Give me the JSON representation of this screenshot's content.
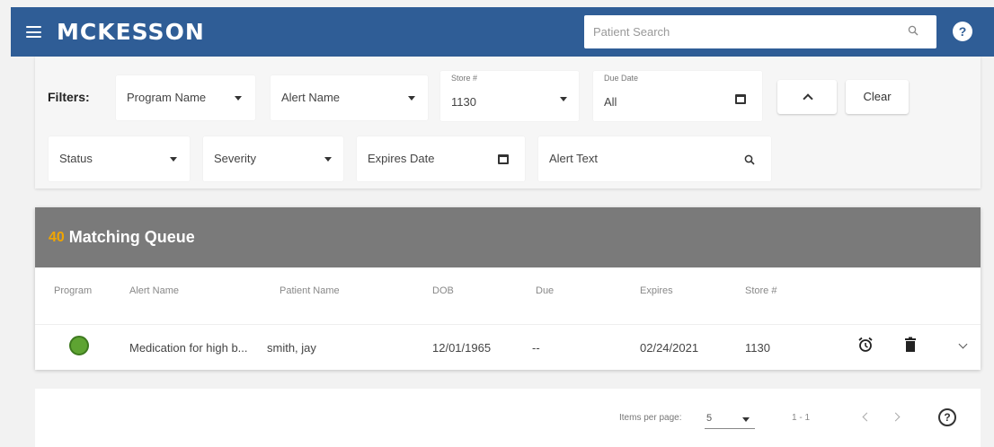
{
  "header": {
    "brand": "MCKESSON",
    "search_placeholder": "Patient Search",
    "help_glyph": "?"
  },
  "filters": {
    "label": "Filters:",
    "program_name": "Program Name",
    "alert_name": "Alert Name",
    "store_label": "Store #",
    "store_value": "1130",
    "due_date_label": "Due Date",
    "due_date_value": "All",
    "clear_label": "Clear",
    "status": "Status",
    "severity": "Severity",
    "expires_date": "Expires Date",
    "alert_text": "Alert Text"
  },
  "queue": {
    "count": "40",
    "title": "Matching Queue",
    "columns": [
      "Program",
      "Alert Name",
      "Patient Name",
      "DOB",
      "Due",
      "Expires",
      "Store #"
    ],
    "rows": [
      {
        "alert_name": "Medication for high b...",
        "patient_name": "smith, jay",
        "dob": "12/01/1965",
        "due": "--",
        "expires": "02/24/2021",
        "store": "1130"
      }
    ]
  },
  "paginator": {
    "items_per_page_label": "Items per page:",
    "items_per_page_value": "5",
    "range": "1 - 1",
    "help_glyph": "?"
  },
  "icons": {
    "menu": "hamburger-icon",
    "search": "search-icon",
    "help": "help-icon",
    "calendar": "calendar-icon",
    "alarm": "alarm-icon",
    "trash": "trash-icon",
    "expand": "chevron-down-icon"
  },
  "colors": {
    "header_bg": "#2f5d96",
    "queue_header_bg": "#7a7a7a",
    "count_accent": "#f0a500",
    "program_icon": "#5ea432"
  }
}
